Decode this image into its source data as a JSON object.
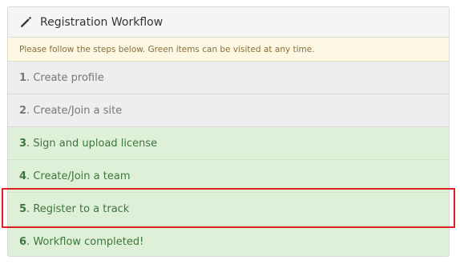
{
  "panel": {
    "title": "Registration Workflow",
    "icon": "pencil-icon",
    "notice": "Please follow the steps below. Green items can be visited at any time."
  },
  "steps": [
    {
      "number": "1",
      "label": "Create profile",
      "status": "disabled"
    },
    {
      "number": "2",
      "label": "Create/Join a site",
      "status": "disabled"
    },
    {
      "number": "3",
      "label": "Sign and upload license",
      "status": "success"
    },
    {
      "number": "4",
      "label": "Create/Join a team",
      "status": "success"
    },
    {
      "number": "5",
      "label": "Register to a track",
      "status": "success"
    },
    {
      "number": "6",
      "label": "Workflow completed!",
      "status": "success"
    }
  ],
  "colors": {
    "disabled_bg": "#eeeeee",
    "success_bg": "#dff0d8",
    "success_text": "#3c763d",
    "notice_bg": "#fcf8e3",
    "highlight": "#e02020"
  }
}
